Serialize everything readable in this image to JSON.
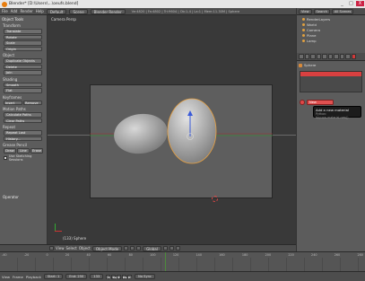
{
  "window": {
    "title": "Blender* [D:\\Users\\...\\oeufs.blend]",
    "controls": [
      "_",
      "□",
      "X"
    ]
  },
  "infobar": {
    "menus": [
      "File",
      "Add",
      "Render",
      "Help"
    ],
    "layout": "Default",
    "scene": "Scene",
    "engine": "Blender Render",
    "stats": "Ve:4820 | Fa:4802 | Tri:9604 | Ob:1-4 | La:1 | Mem:11.30M | Sphere"
  },
  "toolshelf": {
    "title": "Object Tools",
    "sections": [
      {
        "name": "Transform",
        "buttons": [
          "Translate",
          "Rotate",
          "Scale"
        ],
        "extra": [
          "Origin"
        ]
      },
      {
        "name": "Object",
        "buttons": [
          "Duplicate Objects",
          "Delete",
          "Join"
        ]
      },
      {
        "name": "Shading",
        "row": [
          "Smooth",
          "Flat"
        ]
      },
      {
        "name": "Keyframes",
        "row": [
          "Insert",
          "Remove"
        ]
      },
      {
        "name": "Motion Paths",
        "buttons": [
          "Calculate Paths",
          "Clear Paths"
        ]
      },
      {
        "name": "Repeat",
        "buttons": [
          "Repeat Last",
          "History..."
        ]
      },
      {
        "name": "Grease Pencil",
        "triple": [
          "Draw",
          "Line",
          "Erase"
        ],
        "check": "Use Sketching Sessions"
      }
    ],
    "operator_title": "Operator"
  },
  "viewport": {
    "label": "Camera Persp",
    "object_label": "(133) Sphere"
  },
  "viewport_header": {
    "menus": [
      "View",
      "Select",
      "Object"
    ],
    "mode": "Object Mode",
    "pivot": "Global"
  },
  "timeline": {
    "ticks": [
      "-40",
      "-20",
      "0",
      "20",
      "40",
      "60",
      "80",
      "100",
      "120",
      "140",
      "160",
      "180",
      "200",
      "220",
      "240",
      "260",
      "280"
    ],
    "current_frame": 133,
    "header_menus": [
      "View",
      "Frame",
      "Playback"
    ],
    "start": "Start: 1",
    "end": "End: 250",
    "frame_field": "133",
    "sync": "No Sync"
  },
  "outliner": {
    "menus": [
      "View",
      "Search",
      "All Scenes"
    ],
    "items": [
      "RenderLayers",
      "World",
      "Camera",
      "Plane",
      "Lamp"
    ]
  },
  "properties": {
    "context_label": "Sphere",
    "new_button": "New",
    "tooltip_main": "Add a new material",
    "tooltip_python": "Python: bpy.ops.material.new()"
  },
  "colors": {
    "accent": "#d94040",
    "playhead": "#4c8a3c",
    "object_outline": "#e8a040"
  }
}
